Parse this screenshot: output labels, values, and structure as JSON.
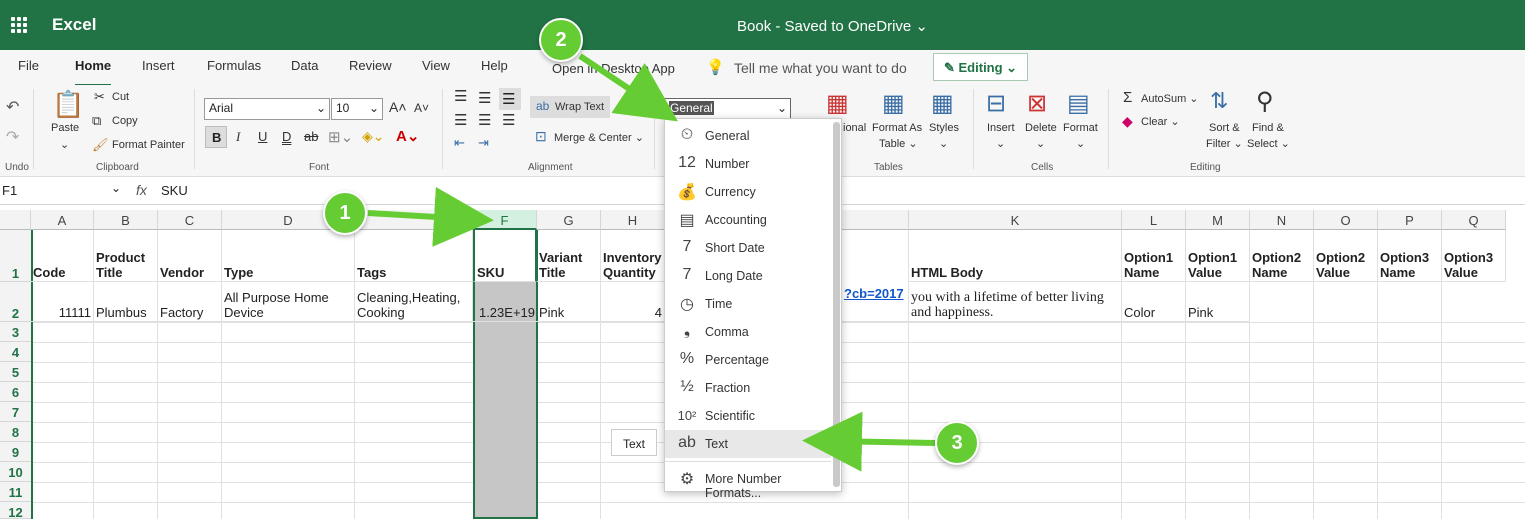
{
  "app": {
    "name": "Excel",
    "doc_title": "Book  -  Saved to OneDrive ⌄"
  },
  "tabs": [
    "File",
    "Home",
    "Insert",
    "Formulas",
    "Data",
    "Review",
    "View",
    "Help",
    "Open in Desktop App"
  ],
  "tellme": "Tell me what you want to do",
  "editing": "Editing ⌄",
  "ribbon": {
    "undo_group": "Undo",
    "paste": "Paste",
    "cut": "Cut",
    "copy": "Copy",
    "format_painter": "Format Painter",
    "clipboard_group": "Clipboard",
    "font_name": "Arial",
    "font_size": "10",
    "font_group": "Font",
    "wrap_text": "Wrap Text",
    "merge_center": "Merge & Center ⌄",
    "alignment_group": "Alignment",
    "number_format": "General",
    "conditional": "ional",
    "format_as_table": "Format As",
    "format_as_table2": "Table ⌄",
    "styles": "Styles",
    "tables_group": "Tables",
    "insert": "Insert",
    "delete": "Delete",
    "format": "Format",
    "cells_group": "Cells",
    "autosum": "AutoSum ⌄",
    "clear": "Clear ⌄",
    "sort_filter": "Sort &",
    "sort_filter2": "Filter ⌄",
    "find_select": "Find &",
    "find_select2": "Select ⌄",
    "editing_group": "Editing"
  },
  "formula_bar": {
    "name_box": "F1",
    "fx": "fx",
    "value": "SKU"
  },
  "columns": [
    "A",
    "B",
    "C",
    "D",
    "E",
    "F",
    "G",
    "H",
    "K",
    "L",
    "M",
    "N",
    "O",
    "P",
    "Q"
  ],
  "rows": [
    "1",
    "2",
    "3",
    "4",
    "5",
    "6",
    "7",
    "8",
    "9",
    "10",
    "11",
    "12"
  ],
  "row1": [
    "Code",
    "Product Title",
    "Vendor",
    "Type",
    "Tags",
    "SKU",
    "Variant Title",
    "Inventory Quantity",
    "HTML Body",
    "Option1 Name",
    "Option1 Value",
    "Option2 Name",
    "Option2 Value",
    "Option3 Name",
    "Option3 Value"
  ],
  "row2": [
    "11111",
    "Plumbus",
    "Factory",
    "All Purpose Home Device",
    "Cleaning,Heating, Cooking",
    "1.23E+19",
    "Pink",
    "4",
    "?cb=2017",
    "you with a lifetime of better living and happiness.",
    "Color",
    "Pink"
  ],
  "number_formats": [
    {
      "icon": "⏲",
      "label": "General"
    },
    {
      "icon": "12",
      "label": "Number"
    },
    {
      "icon": "💰",
      "label": "Currency"
    },
    {
      "icon": "▤",
      "label": "Accounting"
    },
    {
      "icon": "7",
      "label": "Short Date"
    },
    {
      "icon": "7",
      "label": "Long Date"
    },
    {
      "icon": "◷",
      "label": "Time"
    },
    {
      "icon": "❟",
      "label": "Comma"
    },
    {
      "icon": "%",
      "label": "Percentage"
    },
    {
      "icon": "½",
      "label": "Fraction"
    },
    {
      "icon": "10²",
      "label": "Scientific"
    },
    {
      "icon": "ab",
      "label": "Text"
    },
    {
      "icon": "⚙",
      "label": "More Number Formats..."
    }
  ],
  "tooltip": "Text",
  "callouts": [
    "1",
    "2",
    "3"
  ],
  "accent": "#217346",
  "callout_color": "#66cc33"
}
